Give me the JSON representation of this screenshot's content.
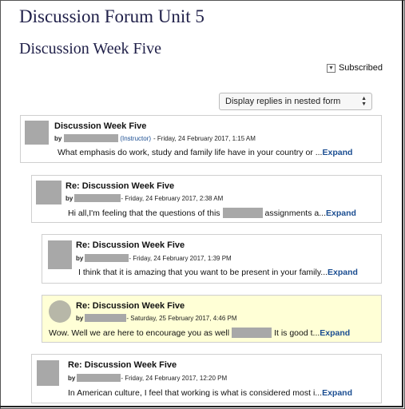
{
  "forum_title": "Discussion Forum Unit 5",
  "discussion_title": "Discussion Week Five",
  "subscribed_label": "Subscribed",
  "display_mode": "Display replies in nested form",
  "expand_label": "Expand",
  "posts": [
    {
      "subject": "Discussion Week Five",
      "by": "by",
      "role": "(Instructor)",
      "date": "- Friday, 24 February 2017, 1:15 AM",
      "excerpt": "What emphasis do work, study and family life have in your country or ..."
    },
    {
      "subject": "Re: Discussion Week Five",
      "by": "by",
      "date": "- Friday, 24 February 2017, 2:38 AM",
      "excerpt_a": "Hi all,I'm feeling that the questions of this",
      "excerpt_b": "assignments a..."
    },
    {
      "subject": "Re: Discussion Week Five",
      "by": "by",
      "date": "- Friday, 24 February 2017, 1:39 PM",
      "excerpt": "I think that it is amazing that you want to be present in your family..."
    },
    {
      "subject": "Re: Discussion Week Five",
      "by": "by",
      "date": "- Saturday, 25 February 2017, 4:46 PM",
      "excerpt_a": "Wow. Well we are here to encourage you as well",
      "excerpt_b": "It is good t..."
    },
    {
      "subject": "Re: Discussion Week Five",
      "by": "by",
      "date": "- Friday, 24 February 2017, 12:20 PM",
      "excerpt": "In American culture, I feel that working is what is considered most i..."
    }
  ]
}
